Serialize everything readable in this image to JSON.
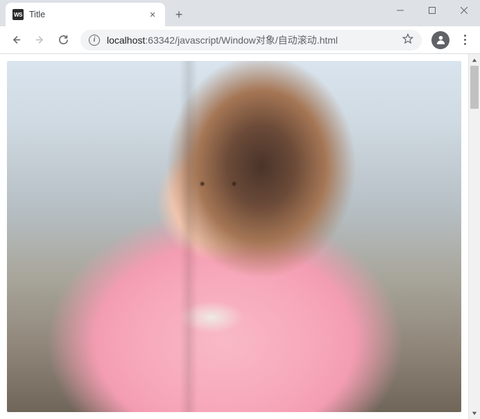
{
  "tab": {
    "favicon_text": "WS",
    "title": "Title"
  },
  "url": {
    "host": "localhost",
    "port": ":63342",
    "path": "/javascript/Window对象/自动滚动.html"
  },
  "content": {
    "image_alt": "photograph"
  }
}
